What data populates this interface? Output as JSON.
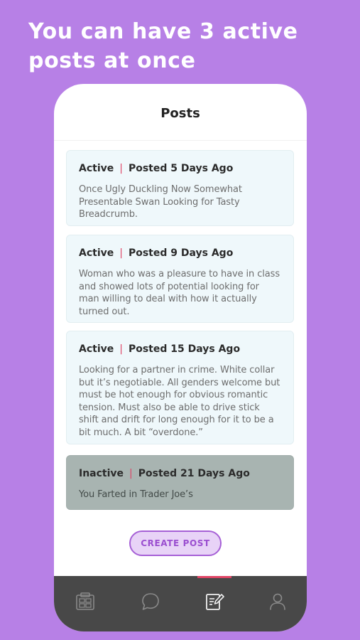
{
  "promo": {
    "headline": "You can have 3 active posts at once"
  },
  "screen": {
    "title": "Posts",
    "posts": [
      {
        "status": "Active",
        "posted": "Posted 5 Days Ago",
        "text": "Once Ugly Duckling Now Somewhat Presentable Swan Looking for Tasty Breadcrumb."
      },
      {
        "status": "Active",
        "posted": "Posted 9 Days Ago",
        "text": "Woman who was a pleasure to have in class and showed lots of potential looking for man willing to deal with how it actually turned out."
      },
      {
        "status": "Active",
        "posted": "Posted 15 Days Ago",
        "text": "Looking for a partner in crime. White collar but it’s negotiable. All genders welcome but must be hot enough for obvious romantic tension. Must also be able to drive stick shift and drift for long enough for it to be a bit much. A bit “overdone.”"
      },
      {
        "status": "Inactive",
        "posted": "Posted 21 Days Ago",
        "text": "You Farted in Trader Joe’s"
      }
    ],
    "separator": "|",
    "create_button": "CREATE POST"
  },
  "tabbar": {
    "items": [
      {
        "icon": "cards-icon",
        "active": false
      },
      {
        "icon": "chat-bubble-icon",
        "active": false
      },
      {
        "icon": "posts-edit-icon",
        "active": true
      },
      {
        "icon": "profile-icon",
        "active": false
      }
    ]
  },
  "colors": {
    "background": "#b780e6",
    "accent": "#9b4fd0",
    "separator": "#e04566",
    "active_card": "#eff8fb",
    "inactive_card": "#a8b4b1",
    "tabbar": "#484848"
  }
}
